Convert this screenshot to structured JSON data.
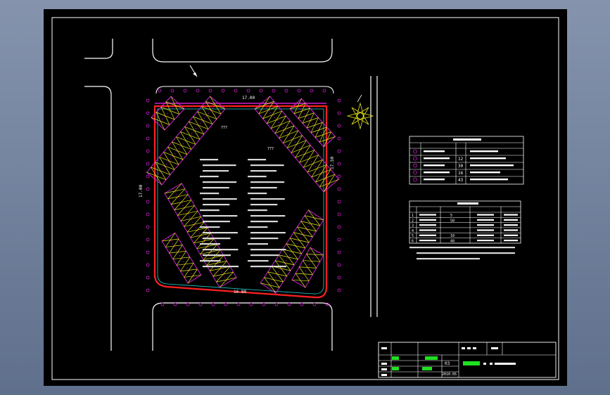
{
  "drawing": {
    "elevations": {
      "top": "17.00",
      "right": "17.50",
      "left": "17.00",
      "bottom": "16.80"
    },
    "small_labels": {
      "a": "777",
      "b": "777"
    }
  },
  "legend_table": {
    "title": "",
    "rows": [
      {
        "no": "1",
        "name": "",
        "qty": "",
        "note": ""
      },
      {
        "no": "2",
        "name": "",
        "qty": "12",
        "note": ""
      },
      {
        "no": "3",
        "name": "",
        "qty": "30",
        "note": ""
      },
      {
        "no": "4",
        "name": "",
        "qty": "16",
        "note": ""
      },
      {
        "no": "5",
        "name": "",
        "qty": "43",
        "note": ""
      }
    ]
  },
  "material_table": {
    "title": "",
    "rows": [
      {
        "no": "1",
        "qty": "5",
        "spec": "",
        "code": ""
      },
      {
        "no": "2",
        "qty": "50",
        "spec": "",
        "code": ""
      },
      {
        "no": "3",
        "qty": "",
        "spec": "",
        "code": ""
      },
      {
        "no": "4",
        "qty": "",
        "spec": "",
        "code": ""
      },
      {
        "no": "5",
        "qty": "10",
        "spec": "",
        "code": ""
      },
      {
        "no": "6",
        "qty": "40",
        "spec": "",
        "code": ""
      }
    ]
  },
  "title_block": {
    "sheet_no": "03",
    "date": "2010.05"
  },
  "colors": {
    "background": "#000000",
    "line": "#ffffff",
    "boundary_red": "#ff2020",
    "tree_magenta": "#d020d0",
    "tree_yellow": "#e6e61a",
    "cyan": "#20d0d0",
    "green": "#20e020"
  }
}
